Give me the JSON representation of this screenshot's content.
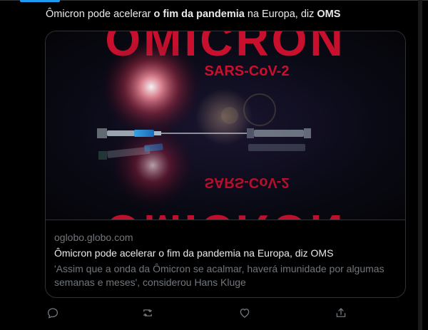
{
  "tweet": {
    "text_part1": "Ômicron pode acelerar ",
    "text_bold1": "o fim da pandemia",
    "text_part2": " na Europa, diz ",
    "text_bold2": "OMS"
  },
  "card": {
    "image": {
      "headline": "ÔMICRON",
      "subheadline": "SARS-CoV-2"
    },
    "domain": "oglobo.globo.com",
    "title": "Ômicron pode acelerar o fim da pandemia na Europa, diz OMS",
    "description": "'Assim que a onda da Ômicron se acalmar, haverá imunidade por algumas semanas e meses', considerou Hans Kluge"
  },
  "actions": [
    {
      "icon": "reply-icon"
    },
    {
      "icon": "retweet-icon"
    },
    {
      "icon": "like-icon"
    },
    {
      "icon": "share-icon"
    }
  ],
  "colors": {
    "background": "#000000",
    "text": "#e7e9ea",
    "secondary_text": "#71767b",
    "border": "#2f3336",
    "accent": "#1d9bf0",
    "headline_red": "#c8102e"
  }
}
